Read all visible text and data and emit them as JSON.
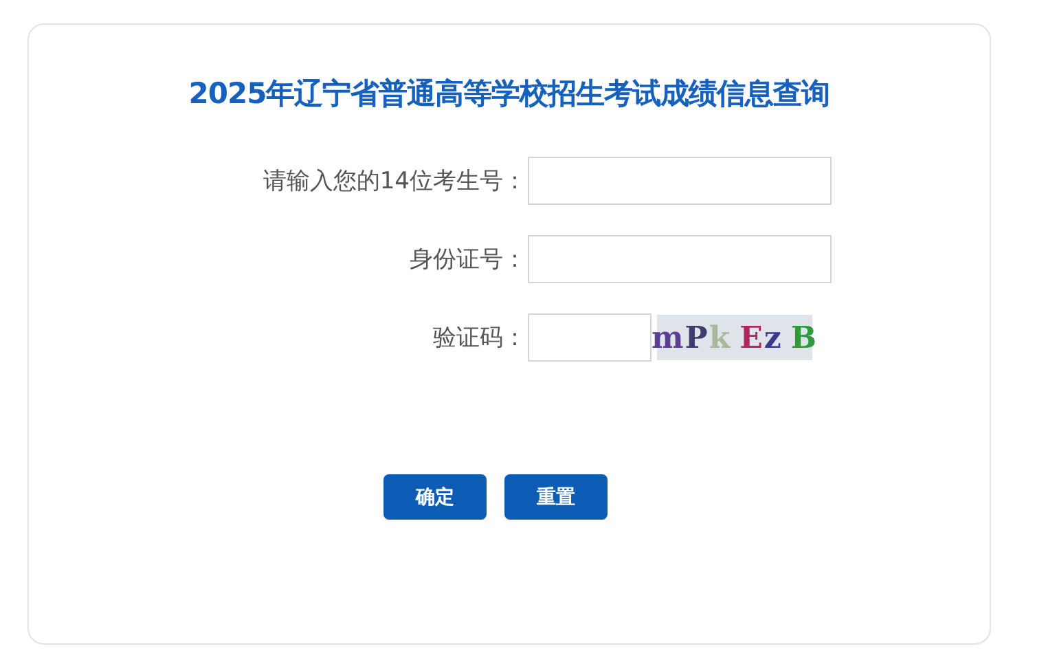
{
  "title": "2025年辽宁省普通高等学校招生考试成绩信息查询",
  "fields": [
    {
      "label": "请输入您的14位考生号：",
      "kind": "text"
    },
    {
      "label": "身份证号：",
      "kind": "text"
    },
    {
      "label": "验证码：",
      "kind": "captcha"
    }
  ],
  "captcha": [
    {
      "char": "m",
      "color": "#5b3f8e"
    },
    {
      "char": "P",
      "color": "#3c3c6e"
    },
    {
      "char": "k",
      "color": "#a9b79a"
    },
    {
      "char": "E",
      "color": "#b0285a"
    },
    {
      "char": "z",
      "color": "#3a3a8c"
    },
    {
      "char": "B",
      "color": "#2f9a3a"
    }
  ],
  "buttons": [
    "确定",
    "重置"
  ]
}
